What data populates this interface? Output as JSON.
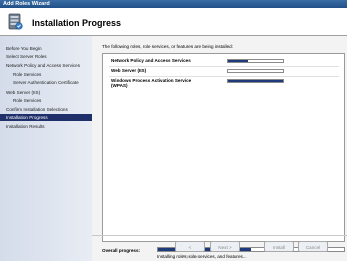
{
  "window": {
    "title": "Add Roles Wizard"
  },
  "header": {
    "title": "Installation Progress",
    "logo_icon": "server-roles-icon"
  },
  "sidebar": {
    "items": [
      {
        "label": "Before You Begin",
        "indent": 0,
        "selected": false
      },
      {
        "label": "Select Server Roles",
        "indent": 0,
        "selected": false
      },
      {
        "label": "Network Policy and Access Services",
        "indent": 0,
        "selected": false
      },
      {
        "label": "Role Services",
        "indent": 1,
        "selected": false
      },
      {
        "label": "Server Authentication Certificate",
        "indent": 1,
        "selected": false
      },
      {
        "label": "Web Server (IIS)",
        "indent": 0,
        "selected": false
      },
      {
        "label": "Role Services",
        "indent": 1,
        "selected": false
      },
      {
        "label": "Confirm Installation Selections",
        "indent": 0,
        "selected": false
      },
      {
        "label": "Installation Progress",
        "indent": 0,
        "selected": true
      },
      {
        "label": "Installation Results",
        "indent": 0,
        "selected": false
      }
    ]
  },
  "main": {
    "intro": "The following roles, role services, or features are being installed:",
    "roles": [
      {
        "name": "Network Policy and Access Services",
        "progress": 0.36
      },
      {
        "name": "Web Server (IIS)",
        "progress": 0.0
      },
      {
        "name": "Windows Process Activation Service\n(WPAS)",
        "progress": 1.0
      }
    ],
    "overall_label": "Overall progress:",
    "overall_progress": 0.5,
    "status": "Installing roles, role services, and features..."
  },
  "buttons": {
    "previous": "< Previous",
    "next": "Next >",
    "install": "Install",
    "cancel": "Cancel"
  },
  "colors": {
    "title_bar": "#2a5d96",
    "selected_nav": "#1f2f6a",
    "progress_fill": "#1f3a7a"
  }
}
